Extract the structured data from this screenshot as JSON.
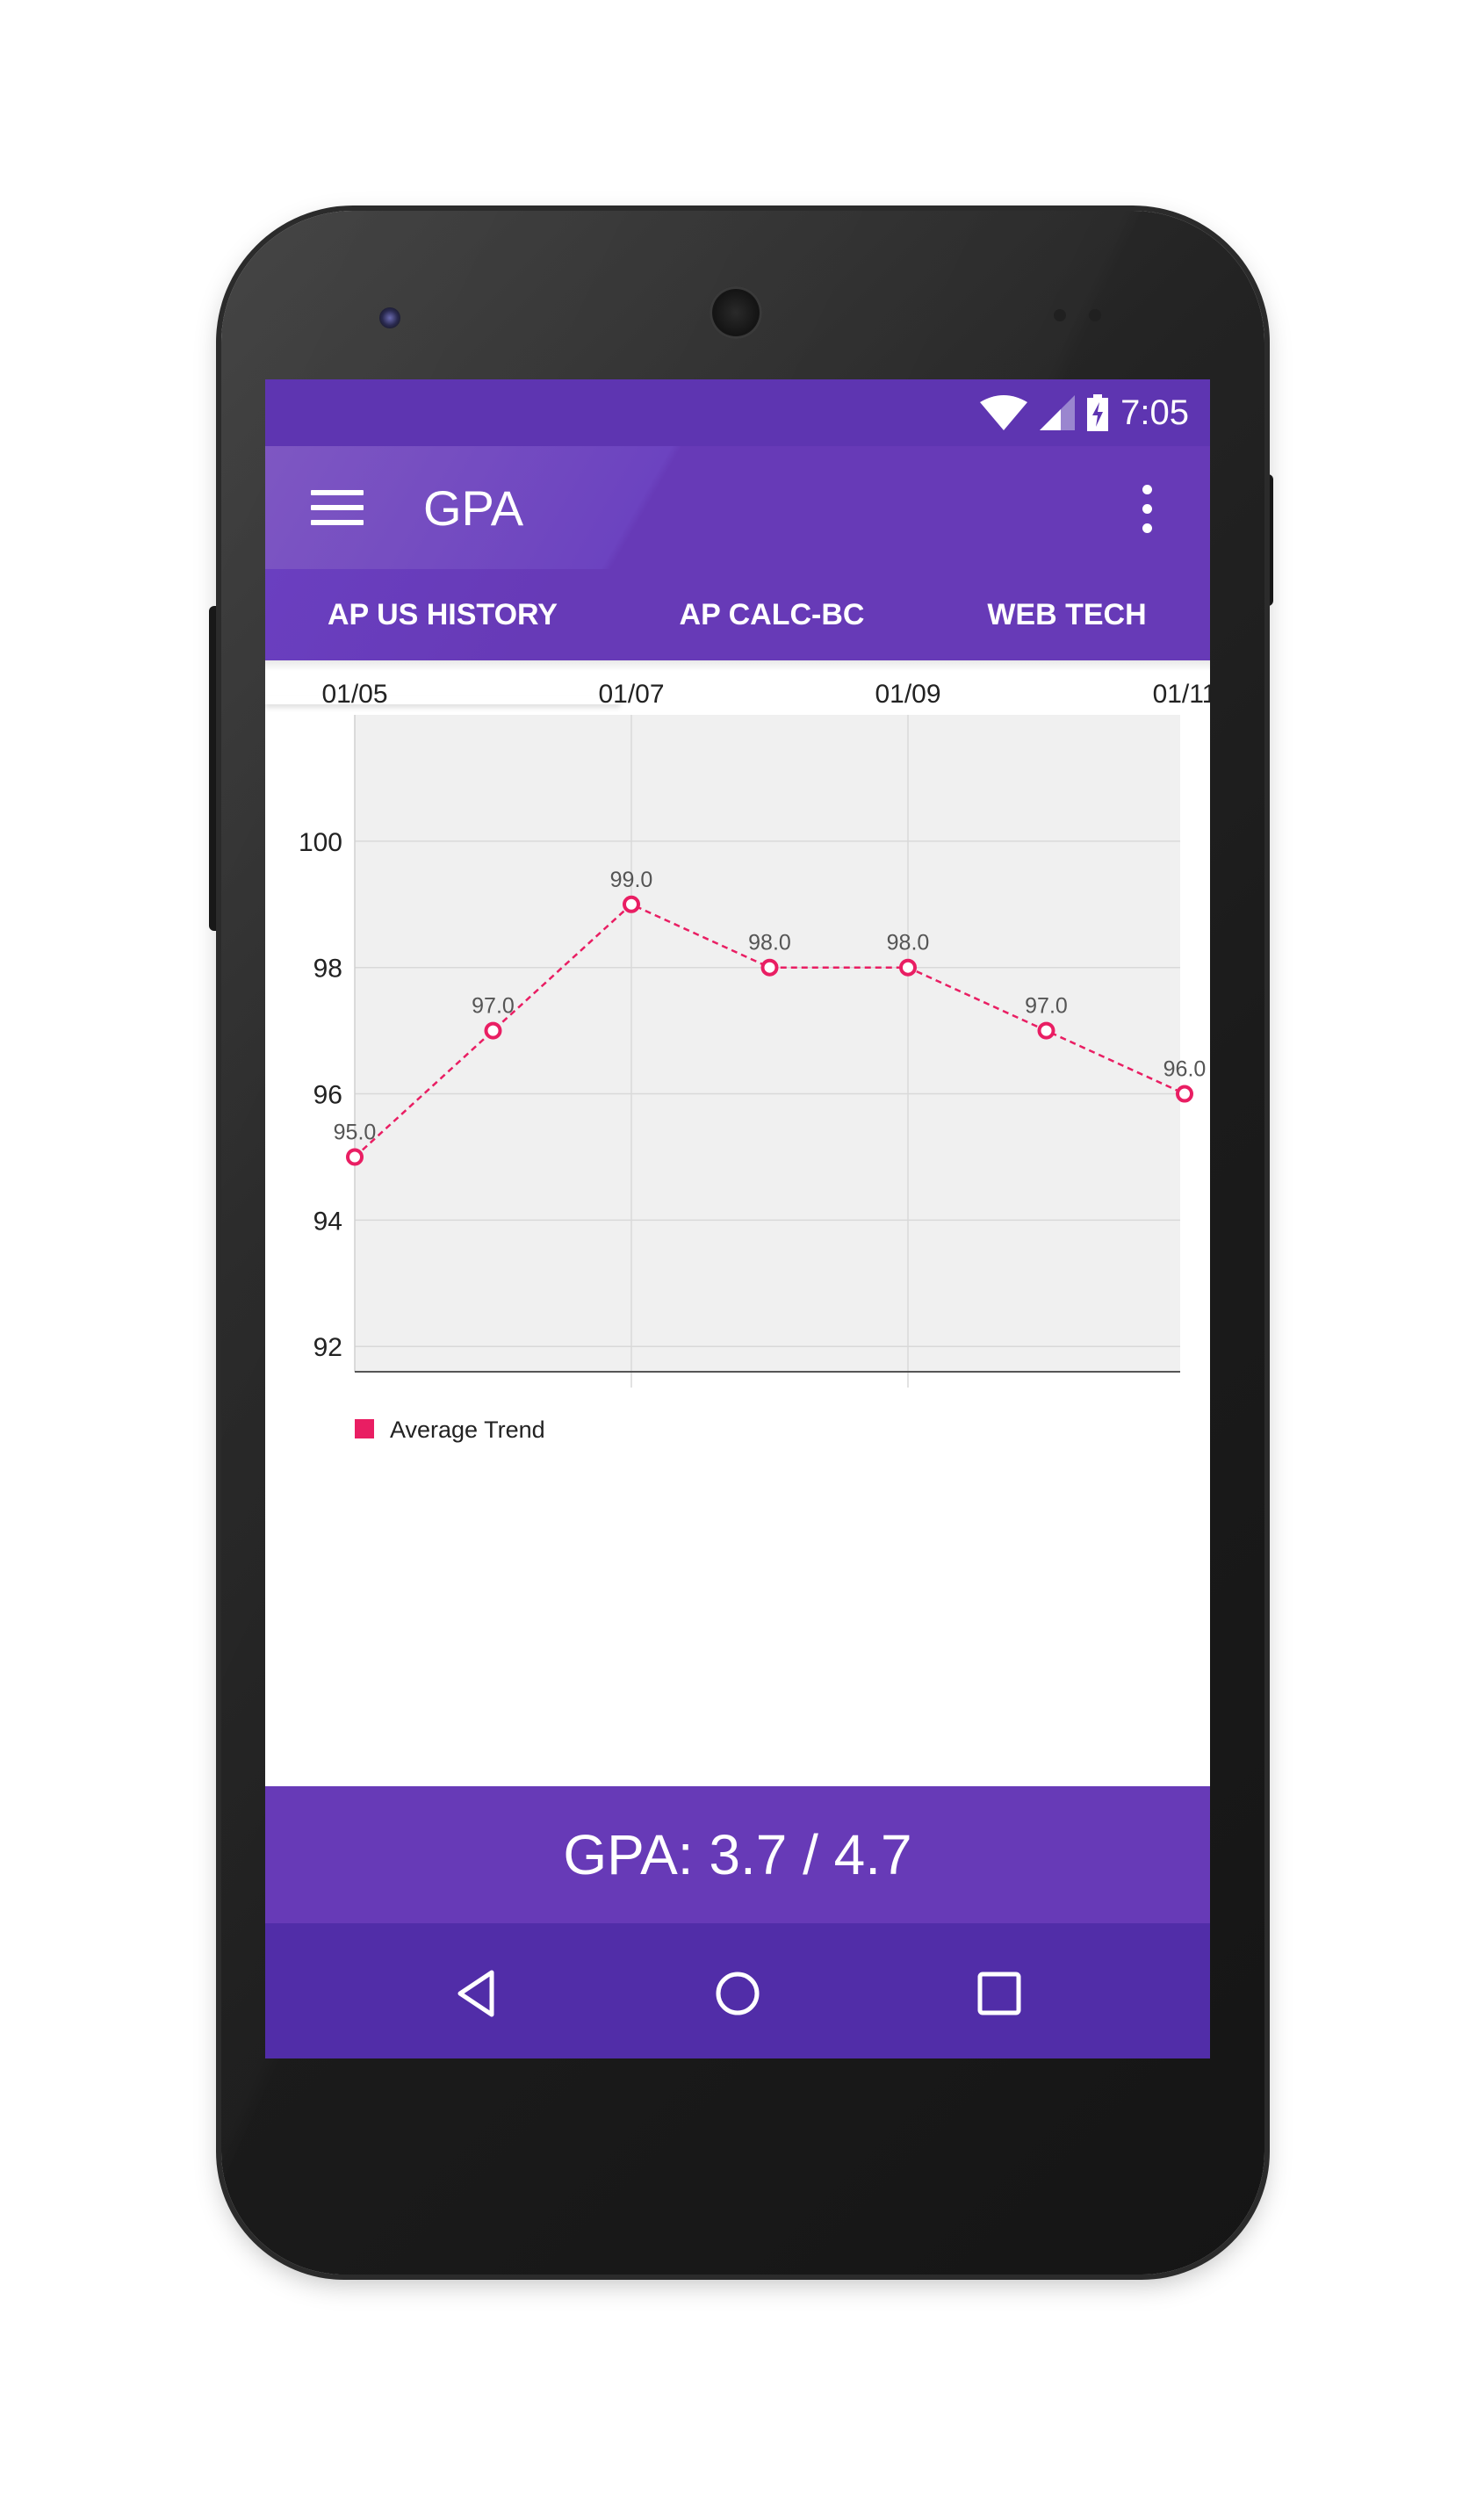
{
  "status_bar": {
    "time": "7:05",
    "icons": [
      "wifi-icon",
      "cell-signal-icon",
      "battery-charging-icon"
    ]
  },
  "app_bar": {
    "title": "GPA",
    "menu_icon": "hamburger-menu-icon",
    "overflow_icon": "more-vert-icon"
  },
  "tabs": [
    {
      "label": "AP US HISTORY",
      "selected": true
    },
    {
      "label": "AP CALC-BC",
      "selected": false
    },
    {
      "label": "WEB TECH",
      "selected": false
    }
  ],
  "footer": {
    "gpa_text": "GPA: 3.7 / 4.7"
  },
  "nav_bar": {
    "icons": [
      "back-icon",
      "home-icon",
      "recents-icon"
    ]
  },
  "colors": {
    "primary": "#673ab7",
    "primary_dark": "#512da8",
    "status_bar": "#5e35b1",
    "accent": "#e91e63",
    "chart_background": "#f0f0f0"
  },
  "chart_data": {
    "type": "line",
    "x": [
      "01/05",
      "01/06",
      "01/07",
      "01/08",
      "01/09",
      "01/10",
      "01/11"
    ],
    "x_tick_labels": [
      "01/05",
      "01/07",
      "01/09",
      "01/11"
    ],
    "series": [
      {
        "name": "Average Trend",
        "color": "#e91e63",
        "values": [
          95.0,
          97.0,
          99.0,
          98.0,
          98.0,
          97.0,
          96.0
        ],
        "value_labels": [
          "95.0",
          "97.0",
          "99.0",
          "98.0",
          "98.0",
          "97.0",
          "96.0"
        ],
        "line_style": "dashed",
        "marker": "hollow-circle"
      }
    ],
    "y_ticks": [
      92,
      94,
      96,
      98,
      100
    ],
    "ylim": [
      91.6,
      102.0
    ],
    "x_axis_position": "top",
    "grid": true,
    "legend": "bottom-left"
  }
}
